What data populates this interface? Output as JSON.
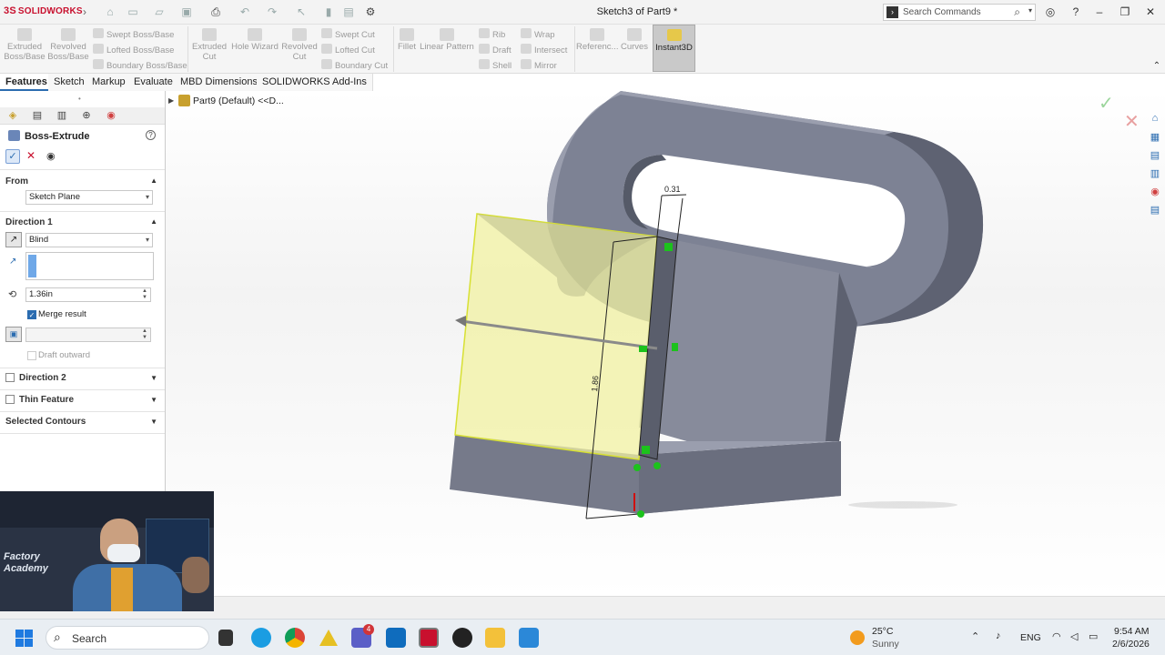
{
  "app": {
    "logo": "SOLIDWORKS",
    "doc_title": "Sketch3 of Part9 *",
    "search_placeholder": "Search Commands"
  },
  "command_manager": {
    "extruded_boss": "Extruded Boss/Base",
    "revolved_boss": "Revolved Boss/Base",
    "swept_boss": "Swept Boss/Base",
    "lofted_boss": "Lofted Boss/Base",
    "boundary_boss": "Boundary Boss/Base",
    "extruded_cut": "Extruded Cut",
    "hole_wizard": "Hole Wizard",
    "revolved_cut": "Revolved Cut",
    "swept_cut": "Swept Cut",
    "lofted_cut": "Lofted Cut",
    "boundary_cut": "Boundary Cut",
    "fillet": "Fillet",
    "linear_pattern": "Linear Pattern",
    "rib": "Rib",
    "draft": "Draft",
    "shell": "Shell",
    "wrap": "Wrap",
    "intersect": "Intersect",
    "mirror": "Mirror",
    "reference": "Referenc...",
    "curves": "Curves",
    "instant3d": "Instant3D"
  },
  "tabs": [
    "Features",
    "Sketch",
    "Markup",
    "Evaluate",
    "MBD Dimensions",
    "SOLIDWORKS Add-Ins"
  ],
  "feature_tree": {
    "root": "Part9 (Default) <<D..."
  },
  "property_manager": {
    "title": "Boss-Extrude",
    "from_label": "From",
    "from_value": "Sketch Plane",
    "direction1_label": "Direction 1",
    "end_condition": "Blind",
    "depth": "1.36in",
    "merge_result": "Merge result",
    "merge_checked": true,
    "draft_outward": "Draft outward",
    "direction2_label": "Direction 2",
    "thin_feature_label": "Thin Feature",
    "selected_contours_label": "Selected Contours"
  },
  "viewport": {
    "dim_top": "0.31",
    "dim_side": "1.86"
  },
  "taskbar": {
    "search": "Search",
    "teams_badge": "4",
    "temperature": "25°C",
    "weather": "Sunny",
    "language": "ENG",
    "time": "9:54 AM",
    "date": "2/6/2026"
  },
  "webcam": {
    "sign_line1": "Factory",
    "sign_line2": "Academy"
  },
  "colors": {
    "brand_red": "#c8102e",
    "accent_blue": "#2b6cb0",
    "model_gray": "#7d8294",
    "preview_yellow": "#f1f2a2"
  }
}
